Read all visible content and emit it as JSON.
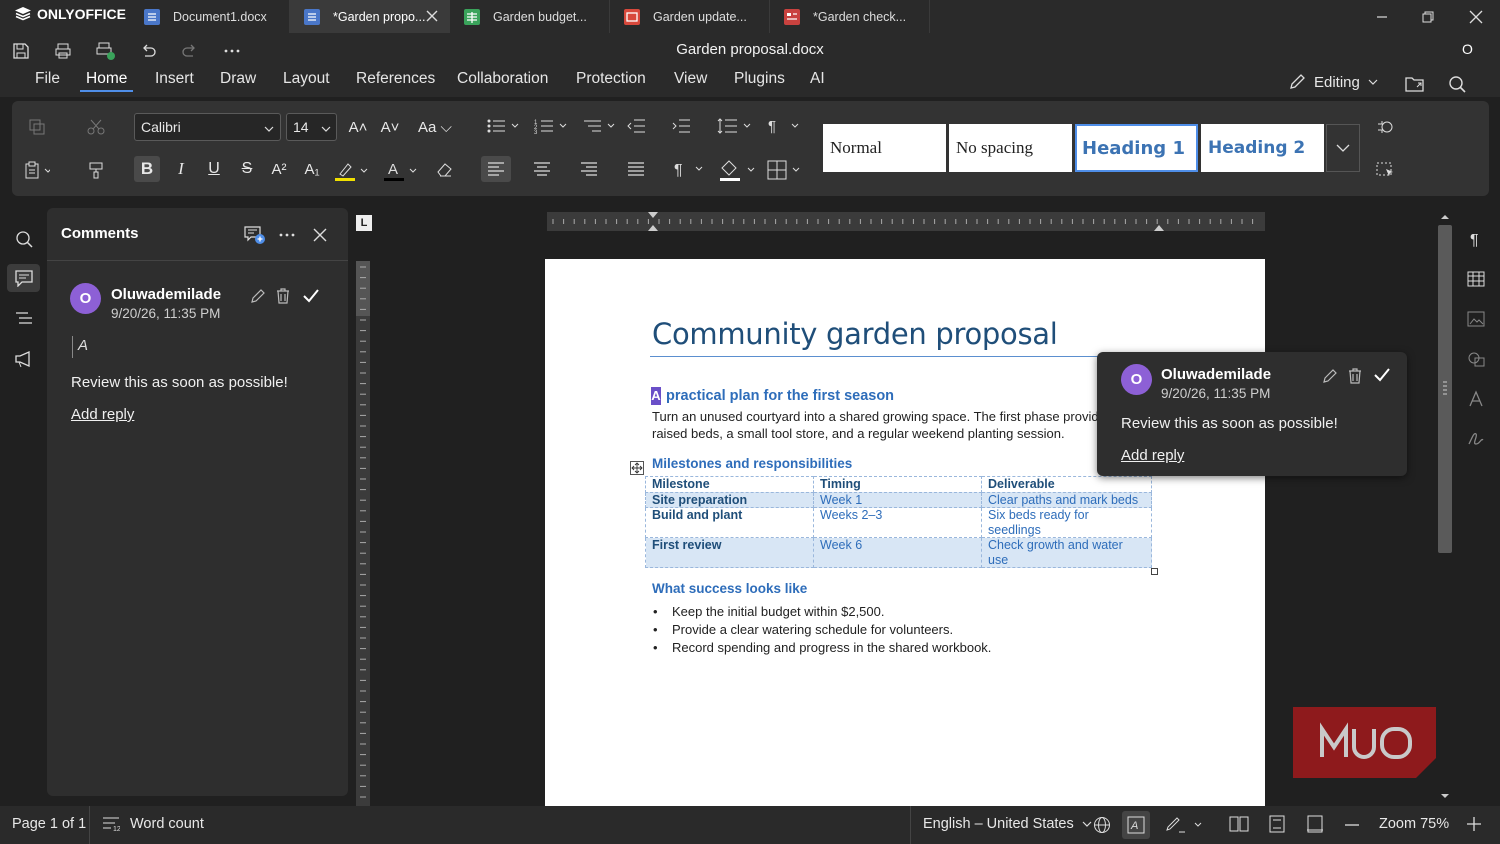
{
  "app": {
    "name": "ONLYOFFICE"
  },
  "tabs": [
    {
      "label": "Document1.docx",
      "type": "doc"
    },
    {
      "label": "*Garden propo...",
      "type": "doc",
      "active": true
    },
    {
      "label": "Garden budget...",
      "type": "sheet"
    },
    {
      "label": "Garden update...",
      "type": "slide"
    },
    {
      "label": "*Garden check...",
      "type": "form"
    }
  ],
  "header": {
    "doc_title": "Garden proposal.docx",
    "user_initial": "O",
    "mode": "Editing"
  },
  "menu": [
    "File",
    "Home",
    "Insert",
    "Draw",
    "Layout",
    "References",
    "Collaboration",
    "Protection",
    "View",
    "Plugins",
    "AI"
  ],
  "toolbar": {
    "font": "Calibri",
    "size": "14",
    "styles": [
      "Normal",
      "No spacing",
      "Heading 1",
      "Heading 2"
    ]
  },
  "comments_panel": {
    "title": "Comments",
    "comment": {
      "initial": "O",
      "author": "Oluwademilade",
      "date": "9/20/26, 11:35 PM",
      "quote": "A",
      "text": "Review this as soon as possible!",
      "reply": "Add reply"
    }
  },
  "document": {
    "title": "Community garden proposal",
    "subhead_marker": "A",
    "subhead": "practical plan for the first season",
    "para_line1": "Turn an unused courtyard into a shared growing space. The first phase provide",
    "para_line2": "raised beds, a small tool store, and a regular weekend planting session.",
    "section1": "Milestones and responsibilities",
    "table": {
      "headers": [
        "Milestone",
        "Timing",
        "Deliverable"
      ],
      "rows": [
        [
          "Site preparation",
          "Week 1",
          "Clear paths and mark beds"
        ],
        [
          "Build and plant",
          "Weeks 2–3",
          "Six beds ready for seedlings"
        ],
        [
          "First review",
          "Week 6",
          "Check growth and water use"
        ]
      ]
    },
    "section2": "What success looks like",
    "bullets": [
      "Keep the initial budget within $2,500.",
      "Provide a clear watering schedule for volunteers.",
      "Record spending and progress in the shared workbook."
    ]
  },
  "status": {
    "page": "Page 1 of 1",
    "word_count": "Word count",
    "language": "English – United States",
    "zoom": "Zoom 75%"
  },
  "watermark": "MUO",
  "colors": {
    "accent": "#4f8ee8",
    "avatar": "#8d60d6",
    "heading": "#2e6dba",
    "title": "#1f4e79"
  }
}
